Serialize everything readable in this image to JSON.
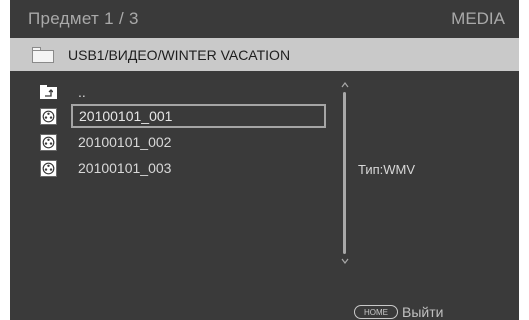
{
  "header": {
    "counter": "Предмет 1 / 3",
    "source": "MEDIA"
  },
  "path": {
    "text": "USB1/ВИДЕО/WINTER VACATION",
    "icon": "folder-icon"
  },
  "list": {
    "parent_label": "..",
    "items": [
      {
        "label": "20100101_001",
        "icon": "video-file-icon",
        "selected": true
      },
      {
        "label": "20100101_002",
        "icon": "video-file-icon",
        "selected": false
      },
      {
        "label": "20100101_003",
        "icon": "video-file-icon",
        "selected": false
      }
    ]
  },
  "info": {
    "type_text": "Тип:WMV"
  },
  "footer": {
    "home_label": "HOME",
    "exit_label": "Выйти"
  },
  "colors": {
    "background": "#3a3a3a",
    "path_bar": "#c9c9c9",
    "text": "#d8d8d8",
    "highlight_border": "#a5a5a5"
  }
}
